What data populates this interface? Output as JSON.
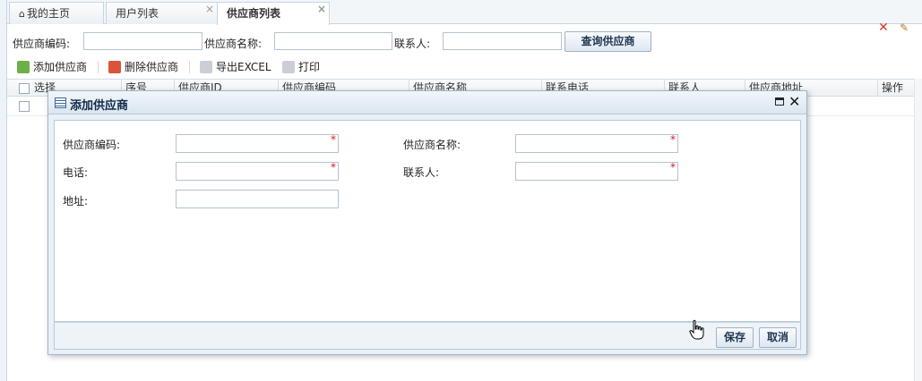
{
  "tabs": [
    {
      "label": "我的主页",
      "icon": "home-icon",
      "closable": false
    },
    {
      "label": "用户列表",
      "closable": true
    },
    {
      "label": "供应商列表",
      "closable": true,
      "active": true
    }
  ],
  "search": {
    "code_label": "供应商编码:",
    "name_label": "供应商名称:",
    "contact_label": "联系人:",
    "code_value": "",
    "name_value": "",
    "contact_value": "",
    "button_label": "查询供应商"
  },
  "toolbar": {
    "add_label": "添加供应商",
    "delete_label": "删除供应商",
    "export_label": "导出EXCEL",
    "print_label": "打印"
  },
  "grid": {
    "headers": [
      "选择",
      "序号",
      "供应商ID",
      "供应商编码",
      "供应商名称",
      "联系电话",
      "联系人",
      "供应商地址",
      "操作"
    ],
    "row_icons": [
      "delete-icon",
      "edit-icon"
    ]
  },
  "dialog": {
    "title": "添加供应商",
    "fields": {
      "code_label": "供应商编码:",
      "name_label": "供应商名称:",
      "phone_label": "电话:",
      "contact_label": "联系人:",
      "address_label": "地址:",
      "required_mark": "*"
    },
    "save_label": "保存",
    "cancel_label": "取消"
  },
  "colors": {
    "accent": "#1f3550",
    "required": "#d21a1a",
    "border": "#b5c3d0"
  }
}
